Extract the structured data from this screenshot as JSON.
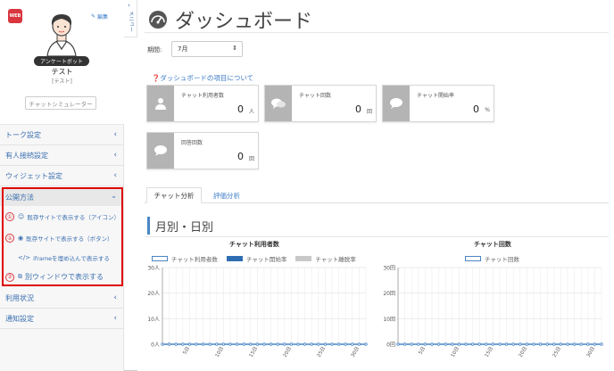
{
  "sidebar": {
    "badge": "WEB",
    "edit_label": "編集",
    "bot_badge": "アンケートボット",
    "bot_name": "テスト",
    "bot_sub": "[テスト]",
    "simulator_button": "チャットシミュレーター",
    "nav": [
      {
        "label": "トーク設定"
      },
      {
        "label": "有人接続設定"
      },
      {
        "label": "ウィジェット設定"
      }
    ],
    "open_section": "公開方法",
    "sub_items": [
      {
        "num": "①",
        "label": "既存サイトで表示する（アイコン）"
      },
      {
        "num": "②",
        "label": "既存サイトで表示する（ボタン）"
      },
      {
        "num": "",
        "label": "iframeを埋め込んで表示する"
      },
      {
        "num": "③",
        "label": "別ウィンドウで表示する"
      }
    ],
    "nav_bottom": [
      {
        "label": "利用状況"
      },
      {
        "label": "通知設定"
      }
    ]
  },
  "menu_toggle": "メニュー",
  "main": {
    "title": "ダッシュボード",
    "period_label": "期間:",
    "period_value": "7月",
    "about_link": "ダッシュボードの項目について",
    "stats": [
      {
        "label": "チャット利用者数",
        "value": "0",
        "unit": "人",
        "icon": "user-icon"
      },
      {
        "label": "チャット回数",
        "value": "0",
        "unit": "回",
        "icon": "chat-bubbles-icon"
      },
      {
        "label": "チャット開始率",
        "value": "0",
        "unit": "%",
        "icon": "chat-bubble-icon"
      },
      {
        "label": "回答回数",
        "value": "0",
        "unit": "回",
        "icon": "chat-bubble-icon"
      }
    ],
    "tabs": [
      "チャット分析",
      "評価分析"
    ],
    "section_title": "月別・日別"
  },
  "chart_data": [
    {
      "type": "line",
      "title": "チャット利用者数",
      "legend": [
        "チャット利用者数",
        "チャット開始率",
        "チャット離脱率"
      ],
      "legend_colors": [
        "#4a86c5",
        "#2f6db3",
        "#c8c8c8"
      ],
      "yticks": [
        "0人",
        "10人",
        "20人",
        "30人"
      ],
      "ylim": [
        0,
        30
      ],
      "xticks": [
        "5日",
        "10日",
        "15日",
        "20日",
        "25日",
        "30日"
      ],
      "x": [
        1,
        2,
        3,
        4,
        5,
        6,
        7,
        8,
        9,
        10,
        11,
        12,
        13,
        14,
        15,
        16,
        17,
        18,
        19,
        20,
        21,
        22,
        23,
        24,
        25,
        26,
        27,
        28,
        29,
        30,
        31
      ],
      "series": [
        {
          "name": "チャット利用者数",
          "values": [
            0,
            0,
            0,
            0,
            0,
            0,
            0,
            0,
            0,
            0,
            0,
            0,
            0,
            0,
            0,
            0,
            0,
            0,
            0,
            0,
            0,
            0,
            0,
            0,
            0,
            0,
            0,
            0,
            0,
            0,
            0
          ]
        }
      ],
      "grid": true
    },
    {
      "type": "line",
      "title": "チャット回数",
      "legend": [
        "チャット回数"
      ],
      "legend_colors": [
        "#4a86c5"
      ],
      "yticks": [
        "0回",
        "10回",
        "20回",
        "30回"
      ],
      "ylim": [
        0,
        30
      ],
      "xticks": [
        "5日",
        "10日",
        "15日",
        "20日",
        "25日",
        "30日"
      ],
      "x": [
        1,
        2,
        3,
        4,
        5,
        6,
        7,
        8,
        9,
        10,
        11,
        12,
        13,
        14,
        15,
        16,
        17,
        18,
        19,
        20,
        21,
        22,
        23,
        24,
        25,
        26,
        27,
        28,
        29,
        30,
        31
      ],
      "series": [
        {
          "name": "チャット回数",
          "values": [
            0,
            0,
            0,
            0,
            0,
            0,
            0,
            0,
            0,
            0,
            0,
            0,
            0,
            0,
            0,
            0,
            0,
            0,
            0,
            0,
            0,
            0,
            0,
            0,
            0,
            0,
            0,
            0,
            0,
            0,
            0
          ]
        }
      ],
      "grid": true
    }
  ]
}
